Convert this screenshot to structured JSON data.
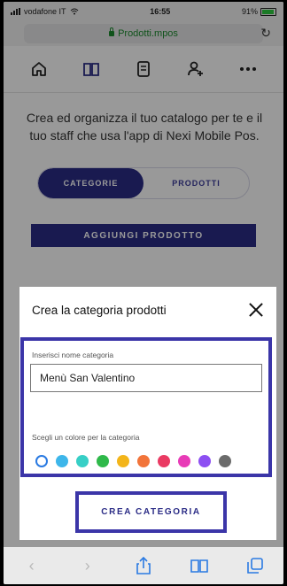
{
  "status": {
    "carrier": "vodafone IT",
    "time": "16:55",
    "battery": "91%"
  },
  "browser": {
    "url": "Prodotti.mpos"
  },
  "page": {
    "description": "Crea ed organizza il tuo catalogo per te e il tuo staff che usa l'app di Nexi Mobile Pos.",
    "tabs": [
      {
        "label": "CATEGORIE"
      },
      {
        "label": "PRODOTTI"
      }
    ],
    "add_product_label": "AGGIUNGI PRODOTTO"
  },
  "modal": {
    "title": "Crea la categoria prodotti",
    "name_label": "Inserisci nome categoria",
    "name_value": "Menù San Valentino",
    "color_label": "Scegli un colore per la categoria",
    "colors": [
      "#ffffff",
      "#3db6ea",
      "#37cfc6",
      "#2fb94a",
      "#f3b51a",
      "#f2743a",
      "#ea3a63",
      "#e83bb7",
      "#8c4ff2",
      "#6b6b6b"
    ],
    "create_label": "CREA CATEGORIA"
  }
}
